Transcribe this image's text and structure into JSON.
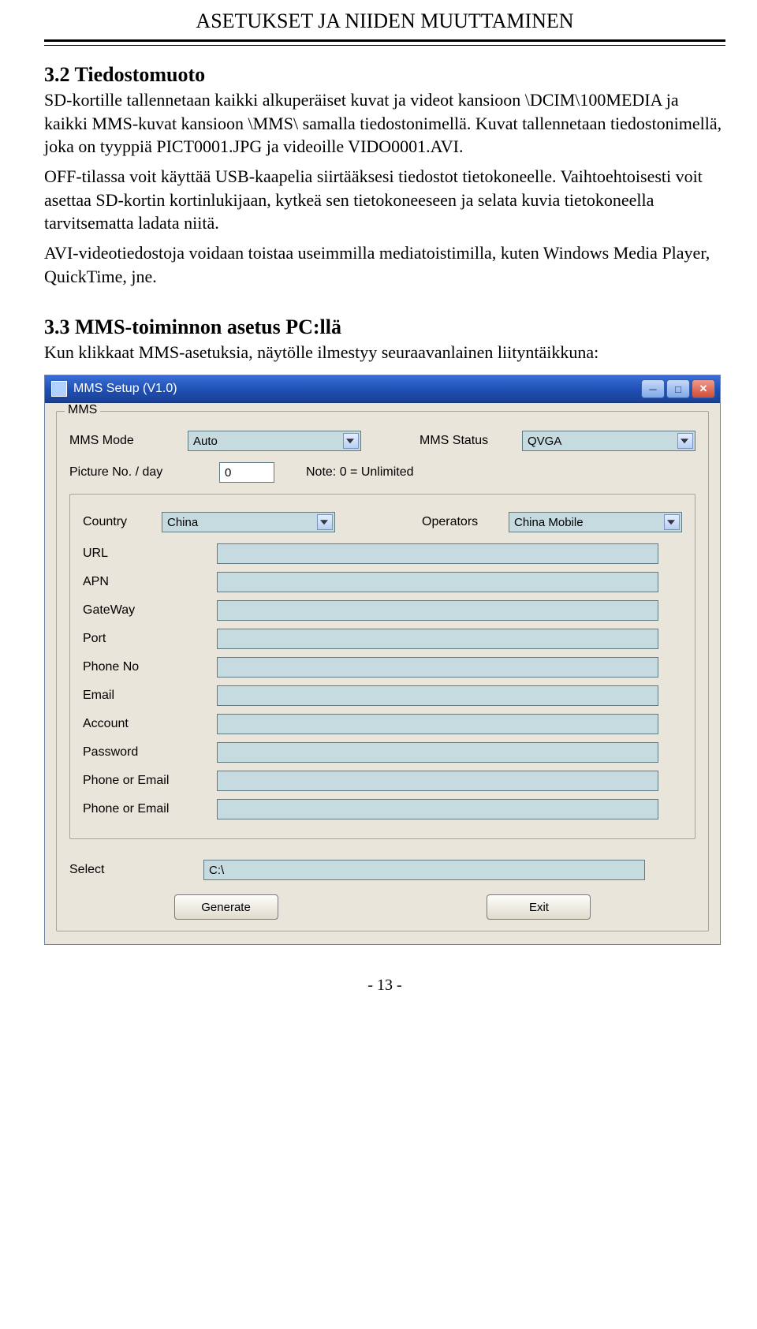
{
  "header": {
    "title": "ASETUKSET JA NIIDEN MUUTTAMINEN"
  },
  "section32": {
    "title": "3.2 Tiedostomuoto",
    "p1": "SD-kortille tallennetaan kaikki alkuperäiset kuvat ja videot kansioon \\DCIM\\100MEDIA ja kaikki MMS-kuvat kansioon \\MMS\\ samalla tiedostonimellä. Kuvat tallennetaan tiedostonimellä, joka on tyyppiä PICT0001.JPG ja videoille VIDO0001.AVI.",
    "p2": "OFF-tilassa voit käyttää USB-kaapelia siirtääksesi tiedostot tietokoneelle. Vaihtoehtoisesti voit asettaa SD-kortin kortinlukijaan, kytkeä sen tietokoneeseen ja selata kuvia tietokoneella tarvitsematta ladata niitä.",
    "p3": "AVI-videotiedostoja voidaan toistaa useimmilla mediatoistimilla, kuten Windows Media Player, QuickTime, jne."
  },
  "section33": {
    "title": "3.3 MMS-toiminnon asetus PC:llä",
    "intro": "Kun klikkaat MMS-asetuksia, näytölle ilmestyy seuraavanlainen liityntäikkuna:"
  },
  "window": {
    "title": "MMS Setup (V1.0)",
    "group_legend": "MMS",
    "mms_mode_label": "MMS Mode",
    "mms_mode_value": "Auto",
    "mms_status_label": "MMS Status",
    "mms_status_value": "QVGA",
    "picno_label": "Picture No. / day",
    "picno_value": "0",
    "picno_note": "Note: 0 = Unlimited",
    "country_label": "Country",
    "country_value": "China",
    "operators_label": "Operators",
    "operators_value": "China Mobile",
    "fields": {
      "url": "URL",
      "apn": "APN",
      "gateway": "GateWay",
      "port": "Port",
      "phoneno": "Phone No",
      "email": "Email",
      "account": "Account",
      "password": "Password",
      "phone_or_email1": "Phone or Email",
      "phone_or_email2": "Phone or Email"
    },
    "select_label": "Select",
    "select_value": "C:\\",
    "generate_btn": "Generate",
    "exit_btn": "Exit",
    "icons": {
      "app": "app-icon",
      "minimize": "minimize-icon",
      "maximize": "maximize-icon",
      "close": "close-icon"
    }
  },
  "page_number": "- 13 -"
}
